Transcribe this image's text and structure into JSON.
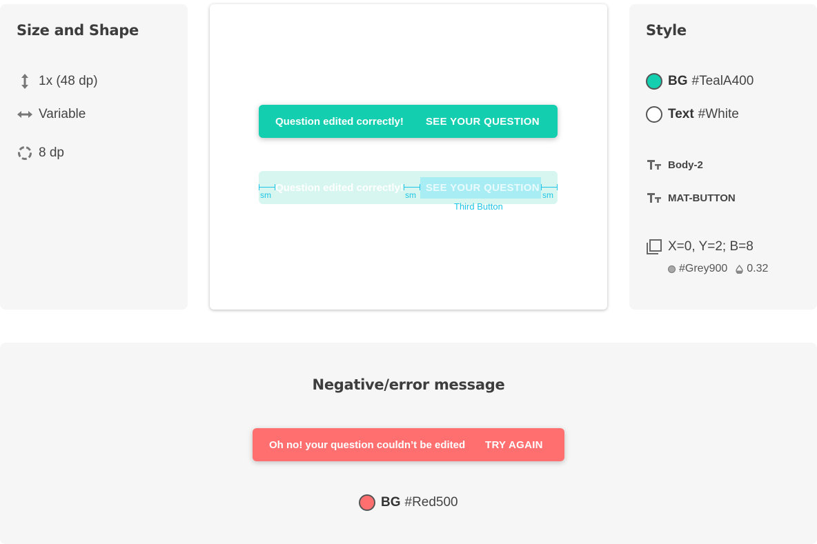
{
  "size_and_shape": {
    "title": "Size and Shape",
    "height": "1x (48 dp)",
    "width": "Variable",
    "radius": "8 dp"
  },
  "preview": {
    "snackbar": {
      "message": "Question edited correctly!",
      "action": "SEE YOUR QUESTION",
      "bg_color": "#14ceb0"
    },
    "spacing": {
      "sm_label_1": "sm",
      "sm_label_2": "sm",
      "sm_label_3": "sm",
      "third_button": "Third Button"
    }
  },
  "style": {
    "title": "Style",
    "bg_label": "BG",
    "bg_value": "#TealA400",
    "bg_swatch": "#14ceb0",
    "text_label": "Text",
    "text_value": "#White",
    "text_swatch": "#ffffff",
    "font_1": "Body-2",
    "font_2": "MAT-BUTTON",
    "shadow": "X=0, Y=2; B=8",
    "shadow_color": "#Grey900",
    "shadow_opacity": "0.32"
  },
  "error": {
    "title": "Negative/error message",
    "message": "Oh no! your question couldn’t be edited",
    "action": "TRY AGAIN",
    "bg_label": "BG",
    "bg_value": "#Red500",
    "bg_swatch": "#ff6f6f"
  }
}
